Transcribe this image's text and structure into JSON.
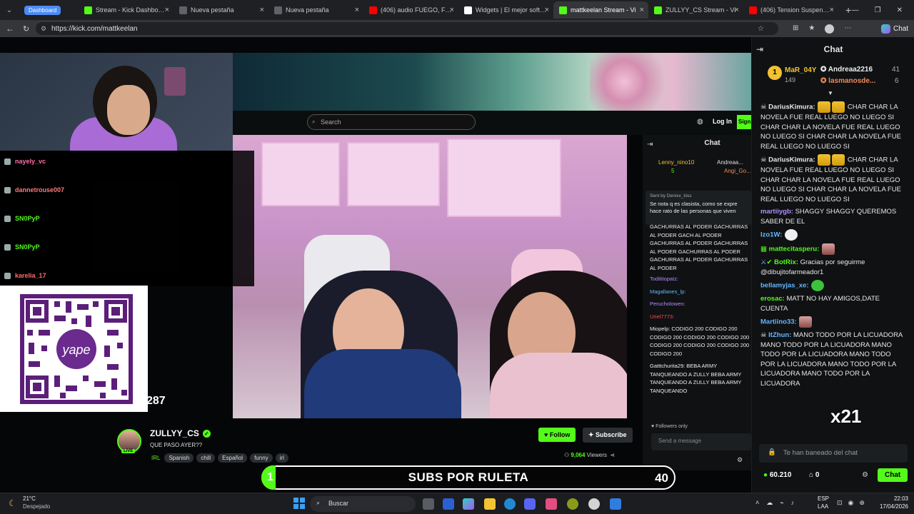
{
  "browser": {
    "tabs": [
      {
        "label": "Dashboard",
        "color": "#4c8bf5",
        "pill": true
      },
      {
        "label": "Stream - Kick Dashboard",
        "color": "#53fc18"
      },
      {
        "label": "Nueva pestaña",
        "color": "#5f6368"
      },
      {
        "label": "Nueva pestaña",
        "color": "#5f6368"
      },
      {
        "label": "(406) audio FUEGO, FUEGO",
        "color": "#ff0000"
      },
      {
        "label": "Widgets | El mejor software",
        "color": "#ffffff"
      },
      {
        "label": "mattkeelan Stream - Vi",
        "color": "#53fc18"
      },
      {
        "label": "ZULLYY_CS Stream - Vi",
        "color": "#53fc18"
      },
      {
        "label": "(406) Tension Suspense Co",
        "color": "#ff0000"
      }
    ],
    "url": "https://kick.com/mattkeelan",
    "chat_profile_label": "Chat"
  },
  "inner_site": {
    "search_placeholder": "Search",
    "login_label": "Log In",
    "signup_label": "Sign",
    "chat_title": "Chat",
    "top_gifters": [
      {
        "name": "Lenny_nino10",
        "count": "5"
      },
      {
        "name": "Andreaa...",
        "count": ""
      },
      {
        "name": "Angi_Go...",
        "count": ""
      }
    ],
    "pinned_by": "Sent by Denixx_kiss",
    "pinned_text": "Se nota q es clasista, como se expre hace rato de las personas que viven",
    "messages": [
      "GACHURRAS AL PODER GACHURRAS AL PODER GACH AL PODER GACHURRAS AL PODER GACHURRAS AL PODER GACHURRAS AL PODER GACHURRAS AL PODER GACHURRAS AL PODER",
      "Todititopatz:",
      "Magallanes_lp:",
      "Perucholowen:",
      "Uriel7773:",
      "Miopelp: CODIGO 200 CODIGO 200 CODIGO 200 CODIGO 200 CODIGO 200 CODIGO 200 CODIGO 200 CODIGO 200 CODIGO 200",
      "Gatttchurita29: BEBA ARMY TANQUEANDO A ZULLY BEBA ARMY TANQUEANDO A ZULLY BEBA ARMY TANQUEANDO"
    ],
    "followers_only": "Followers only",
    "send_placeholder": "Send a message"
  },
  "overlay_chat": [
    {
      "name": "nayely_vc",
      "color": "#ff6fa6"
    },
    {
      "name": "dannetrouse007",
      "color": "#ff7a7a"
    },
    {
      "name": "SN0PyP",
      "color": "#53fc18"
    },
    {
      "name": "SN0PyP",
      "color": "#53fc18"
    },
    {
      "name": "karelia_17",
      "color": "#ff6b6b"
    }
  ],
  "qr_brand": "yape",
  "counter": "287",
  "stream": {
    "channel": "ZULLYY_CS",
    "title": "QUE PASO AYER??",
    "live_badge": "LIVE",
    "tags": [
      "IRL",
      "Spanish",
      "chill",
      "Español",
      "funny",
      "irl"
    ],
    "follow_label": "Follow",
    "subscribe_label": "Subscribe",
    "viewers": "9,064",
    "viewers_label": "Viewers"
  },
  "subs_bar": {
    "label": "SUBS POR RULETA",
    "left_value": "1",
    "right_value": "40"
  },
  "chat": {
    "title": "Chat",
    "top": [
      {
        "name": "MaR_04Y",
        "count": "149"
      },
      {
        "name": "Andreaa2216",
        "count": "41"
      },
      {
        "name": "lasmanosde...",
        "count": "6"
      }
    ],
    "messages": [
      {
        "user": "DariusKimura:",
        "color": "#e8e8e8",
        "text": "CHAR CHAR LA NOVELA FUE REAL LUEGO NO LUEGO SI CHAR CHAR LA NOVELA FUE REAL LUEGO NO LUEGO SI CHAR CHAR LA NOVELA FUE REAL LUEGO NO LUEGO SI"
      },
      {
        "user": "DariusKimura:",
        "color": "#e8e8e8",
        "text": "CHAR CHAR LA NOVELA FUE REAL LUEGO NO LUEGO SI CHAR CHAR LA NOVELA FUE REAL LUEGO NO LUEGO SI CHAR CHAR LA NOVELA FUE REAL LUEGO NO LUEGO SI"
      },
      {
        "user": "martiiygb:",
        "color": "#b18cff",
        "text": "SHAGGY SHAGGY QUEREMOS SABER DE EL"
      },
      {
        "user": "Izo1W:",
        "color": "#65b7ff",
        "text": ""
      },
      {
        "user": "mattecitasperu:",
        "color": "#53fc18",
        "text": ""
      },
      {
        "user": "BotRix:",
        "color": "#53fc18",
        "text": "Gracias por seguirme @dibujitofarmeador1"
      },
      {
        "user": "bellamyjas_xe:",
        "color": "#65b7ff",
        "text": ""
      },
      {
        "user": "erosac:",
        "color": "#53fc18",
        "text": "MATT NO HAY AMIGOS,DATE CUENTA"
      },
      {
        "user": "Martiino33:",
        "color": "#65b7ff",
        "text": ""
      },
      {
        "user": "ItZhun:",
        "color": "#65b7ff",
        "text": "MANO TODO POR LA LICUADORA MANO TODO POR LA LICUADORA MANO TODO POR LA LICUADORA MANO TODO POR LA LICUADORA MANO TODO POR LA LICUADORA MANO TODO POR LA LICUADORA"
      }
    ],
    "x21": "x21",
    "banned_text": "Te han baneado del chat",
    "points": "60.210",
    "gift_count": "0",
    "send_label": "Chat"
  },
  "taskbar": {
    "weather_temp": "21°C",
    "weather_desc": "Despejado",
    "search_label": "Buscar",
    "lang": "ESP",
    "lang2": "LAA",
    "time": "22:03",
    "date": "17/04/2026"
  }
}
